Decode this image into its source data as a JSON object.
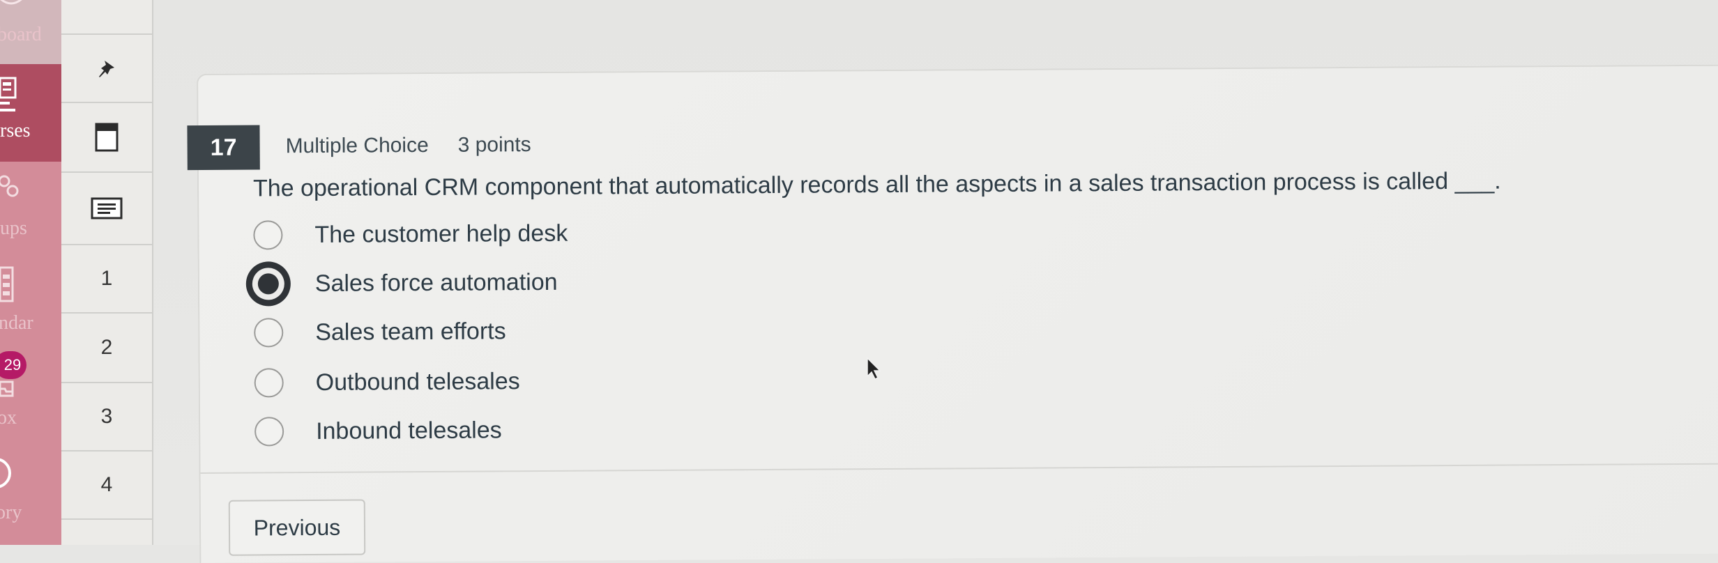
{
  "global_nav": {
    "items": [
      {
        "label": "board",
        "icon": "dashboard-icon"
      },
      {
        "label": "rses",
        "icon": "courses-icon"
      },
      {
        "label": "ups",
        "icon": "groups-icon"
      },
      {
        "label": "ndar",
        "icon": "calendar-icon"
      },
      {
        "label": "ox",
        "icon": "inbox-icon"
      },
      {
        "label": "ory",
        "icon": "history-icon"
      }
    ],
    "inbox_badge": "29",
    "colors": {
      "nav_bg": "#d38c99",
      "active_bg": "#ae4d61",
      "badge_bg": "#b51a66"
    }
  },
  "question_rail": {
    "pin_icon": "pin-icon",
    "items": [
      {
        "type": "icon",
        "icon": "book-icon"
      },
      {
        "type": "icon",
        "icon": "notes-icon"
      },
      {
        "type": "number",
        "label": "1"
      },
      {
        "type": "number",
        "label": "2"
      },
      {
        "type": "number",
        "label": "3"
      },
      {
        "type": "number",
        "label": "4"
      }
    ]
  },
  "question": {
    "number": "17",
    "type": "Multiple Choice",
    "points": "3 points",
    "text": "The operational CRM component that automatically records all the aspects in a sales transaction process is called ___.",
    "options": [
      {
        "label": "The customer help desk",
        "selected": false
      },
      {
        "label": "Sales force automation",
        "selected": true
      },
      {
        "label": "Sales team efforts",
        "selected": false
      },
      {
        "label": "Outbound telesales",
        "selected": false
      },
      {
        "label": "Inbound telesales",
        "selected": false
      }
    ]
  },
  "navigation": {
    "previous_label": "Previous"
  }
}
